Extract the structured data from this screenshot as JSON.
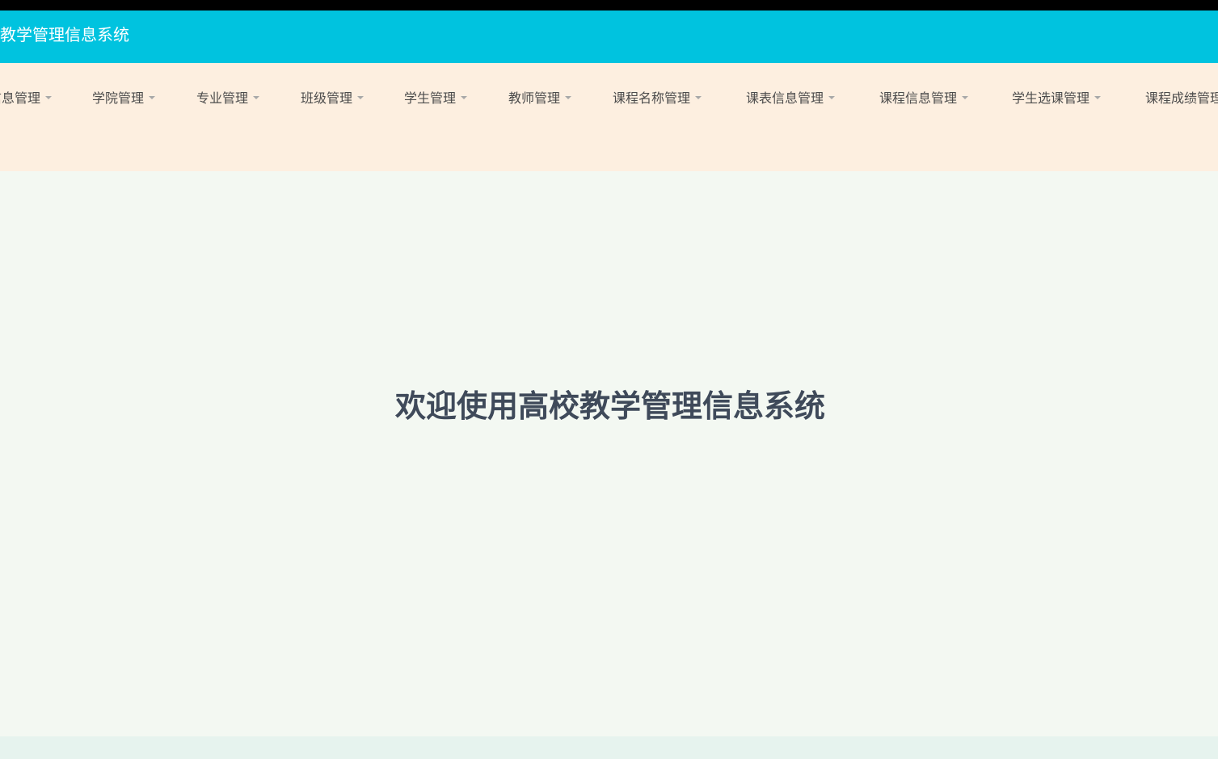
{
  "header": {
    "app_title": "高校教学管理信息系统"
  },
  "nav": {
    "items": [
      {
        "label": "信息管理"
      },
      {
        "label": "学院管理"
      },
      {
        "label": "专业管理"
      },
      {
        "label": "班级管理"
      },
      {
        "label": "学生管理"
      },
      {
        "label": "教师管理"
      },
      {
        "label": "课程名称管理"
      },
      {
        "label": "课表信息管理"
      },
      {
        "label": "课程信息管理"
      },
      {
        "label": "学生选课管理"
      },
      {
        "label": "课程成绩管理"
      }
    ]
  },
  "main": {
    "welcome": "欢迎使用高校教学管理信息系统"
  },
  "colors": {
    "header_bg": "#00c3df",
    "nav_bg": "#fdefe0",
    "main_bg": "#f3f8f2",
    "welcome_text": "#3f4a5a"
  }
}
